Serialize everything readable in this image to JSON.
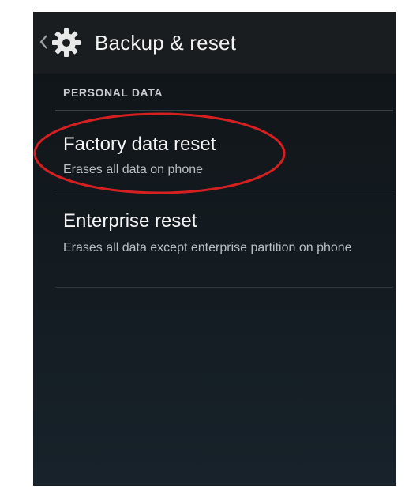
{
  "action_bar": {
    "title": "Backup & reset",
    "back_icon": "chevron-left-icon",
    "app_icon": "settings-gear-icon"
  },
  "section": {
    "header": "PERSONAL DATA"
  },
  "items": [
    {
      "title": "Factory data reset",
      "summary": "Erases all data on phone"
    },
    {
      "title": "Enterprise reset",
      "summary": "Erases all data except enterprise partition on phone"
    }
  ],
  "annotation": {
    "highlight_color": "#d42020"
  }
}
